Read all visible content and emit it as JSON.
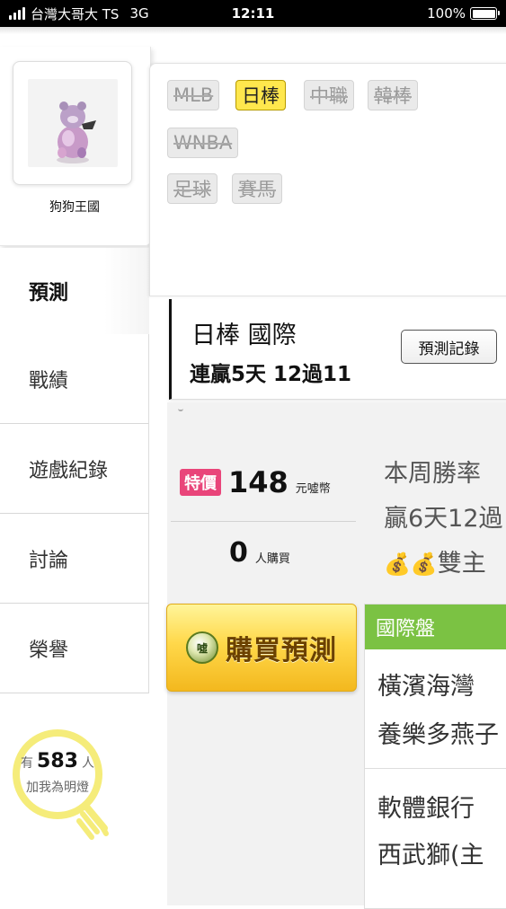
{
  "status_bar": {
    "carrier": "台灣大哥大 TS",
    "network": "3G",
    "time": "12:11",
    "battery": "100%"
  },
  "profile": {
    "nickname": "狗狗王國"
  },
  "menu": {
    "items": [
      {
        "label": "預測",
        "active": true
      },
      {
        "label": "戰績",
        "active": false
      },
      {
        "label": "遊戲紀錄",
        "active": false
      },
      {
        "label": "討論",
        "active": false
      },
      {
        "label": "榮譽",
        "active": false
      }
    ]
  },
  "fans": {
    "prefix": "有",
    "count": "583",
    "suffix": "人",
    "cta": "加我為明燈"
  },
  "sports": {
    "tags": [
      {
        "label": "MLB",
        "active": false
      },
      {
        "label": "日棒",
        "active": true
      },
      {
        "label": "中職",
        "active": false
      },
      {
        "label": "韓棒",
        "active": false
      },
      {
        "label": "WNBA",
        "active": false
      },
      {
        "label": "足球",
        "active": false
      },
      {
        "label": "賽馬",
        "active": false
      }
    ]
  },
  "prediction": {
    "title": "日棒 國際",
    "streak": "連贏5天 12過11",
    "record_button": "預測記錄",
    "badge": "特價",
    "price": "148",
    "currency": "元噓幣",
    "buyers": "0",
    "buyers_unit": "人購買",
    "buy_button": "購買預測",
    "coin_text": "噓"
  },
  "weekly": {
    "line1": "本周勝率",
    "line2": "贏6天12過",
    "line3": "雙主"
  },
  "intl": {
    "header": "國際盤",
    "matches": [
      {
        "home": "橫濱海灣",
        "away": "養樂多燕子"
      },
      {
        "home": "軟體銀行",
        "away": "西武獅(主"
      }
    ]
  },
  "colors": {
    "active_tag": "#ffe74d",
    "badge": "#e9457a",
    "intl_header": "#7bc243",
    "buy_button": "#ffd84a",
    "bulb": "#f5ec7a"
  }
}
